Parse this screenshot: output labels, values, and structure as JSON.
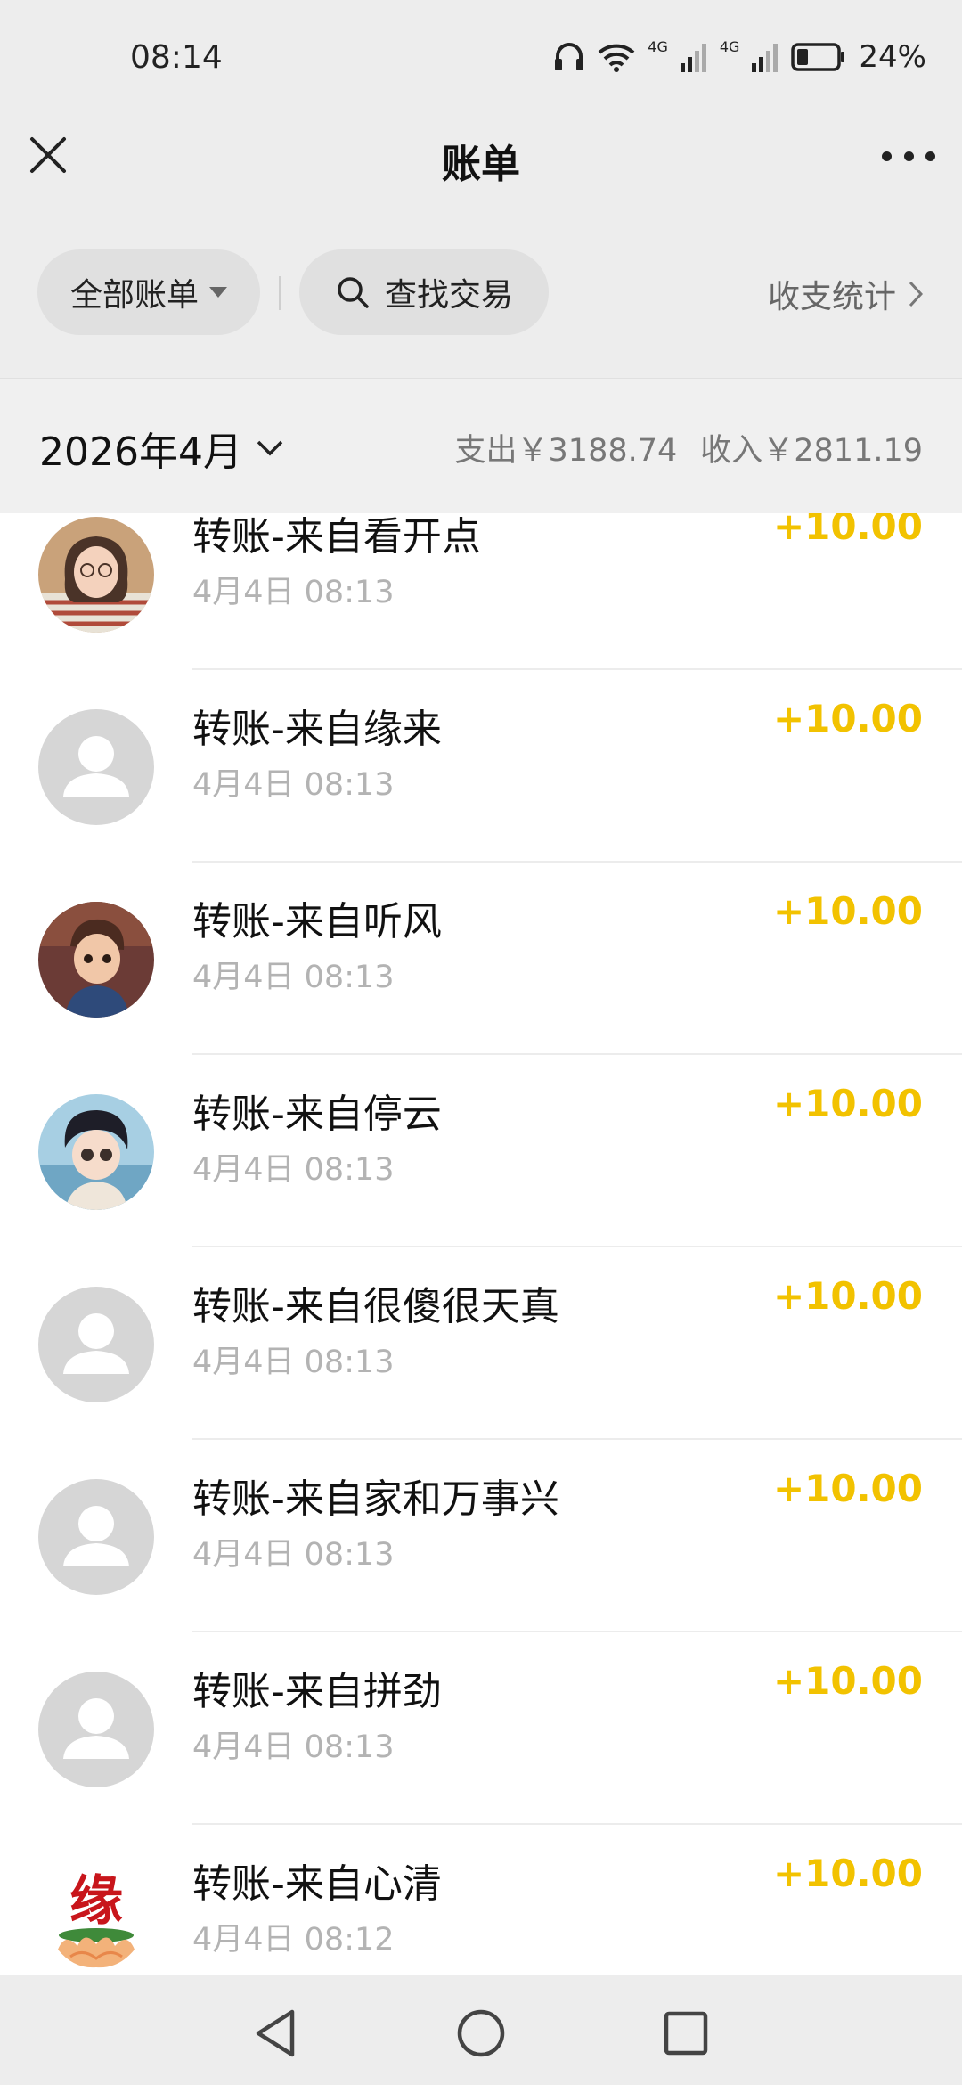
{
  "status": {
    "time": "08:14",
    "battery": "24%",
    "net1": "4G",
    "net2": "4G",
    "icons": [
      "headphones-icon",
      "wifi-icon",
      "signal-icon",
      "signal-icon",
      "battery-icon"
    ]
  },
  "header": {
    "title": "账单",
    "close_icon": "close-icon",
    "more_icon": "more-icon"
  },
  "filters": {
    "all_label": "全部账单",
    "search_label": "查找交易",
    "stats_label": "收支统计"
  },
  "month": {
    "label": "2026年4月",
    "expense": "支出￥3188.74",
    "income": "收入￥2811.19"
  },
  "transactions": [
    {
      "title": "转账-来自看开点",
      "time": "4月4日 08:13",
      "amount": "+10.00",
      "avatar": "photo-girl"
    },
    {
      "title": "转账-来自缘来",
      "time": "4月4日 08:13",
      "amount": "+10.00",
      "avatar": "default-avatar"
    },
    {
      "title": "转账-来自听风",
      "time": "4月4日 08:13",
      "amount": "+10.00",
      "avatar": "photo-boy"
    },
    {
      "title": "转账-来自停云",
      "time": "4月4日 08:13",
      "amount": "+10.00",
      "avatar": "photo-child"
    },
    {
      "title": "转账-来自很傻很天真",
      "time": "4月4日 08:13",
      "amount": "+10.00",
      "avatar": "default-avatar"
    },
    {
      "title": "转账-来自家和万事兴",
      "time": "4月4日 08:13",
      "amount": "+10.00",
      "avatar": "default-avatar"
    },
    {
      "title": "转账-来自拼劲",
      "time": "4月4日 08:13",
      "amount": "+10.00",
      "avatar": "default-avatar"
    },
    {
      "title": "转账-来自心清",
      "time": "4月4日 08:12",
      "amount": "+10.00",
      "avatar": "lotus-yuan"
    }
  ],
  "colors": {
    "amount": "#f2c200",
    "header_bg": "#ededed"
  }
}
